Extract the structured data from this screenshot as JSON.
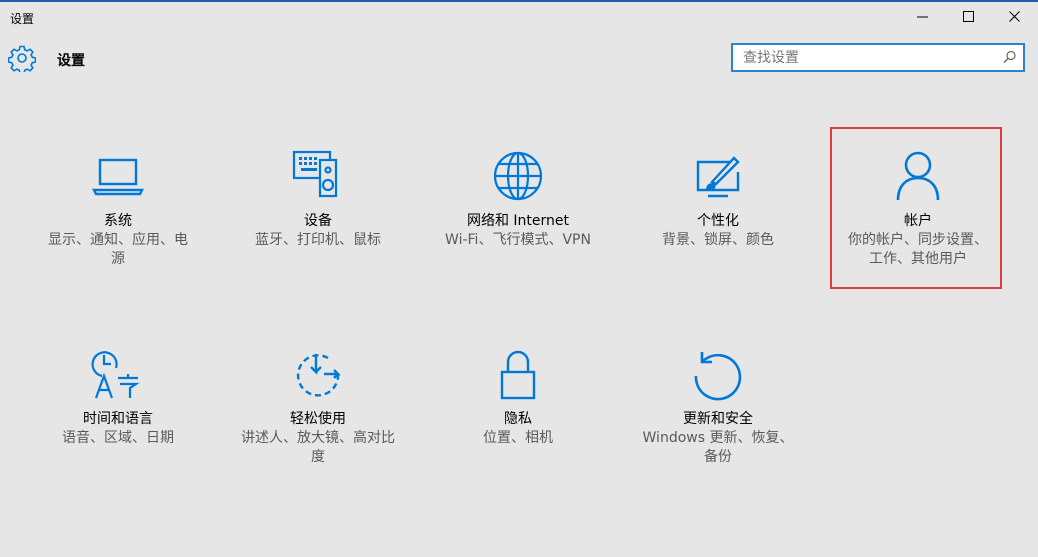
{
  "window": {
    "title": "设置"
  },
  "header": {
    "title": "设置"
  },
  "search": {
    "placeholder": "查找设置"
  },
  "colors": {
    "accent": "#0078d7",
    "highlight": "#e23b3b",
    "background": "#e6e6e6"
  },
  "tiles": [
    {
      "label": "系统",
      "desc": "显示、通知、应用、电源",
      "icon": "laptop-icon"
    },
    {
      "label": "设备",
      "desc": "蓝牙、打印机、鼠标",
      "icon": "devices-icon"
    },
    {
      "label": "网络和 Internet",
      "desc": "Wi-Fi、飞行模式、VPN",
      "icon": "globe-icon"
    },
    {
      "label": "个性化",
      "desc": "背景、锁屏、颜色",
      "icon": "paint-brush-icon"
    },
    {
      "label": "帐户",
      "desc": "你的帐户、同步设置、工作、其他用户",
      "icon": "person-icon"
    },
    {
      "label": "时间和语言",
      "desc": "语音、区域、日期",
      "icon": "time-language-icon"
    },
    {
      "label": "轻松使用",
      "desc": "讲述人、放大镜、高对比度",
      "icon": "ease-of-access-icon"
    },
    {
      "label": "隐私",
      "desc": "位置、相机",
      "icon": "lock-icon"
    },
    {
      "label": "更新和安全",
      "desc": "Windows 更新、恢复、备份",
      "icon": "refresh-icon"
    }
  ]
}
